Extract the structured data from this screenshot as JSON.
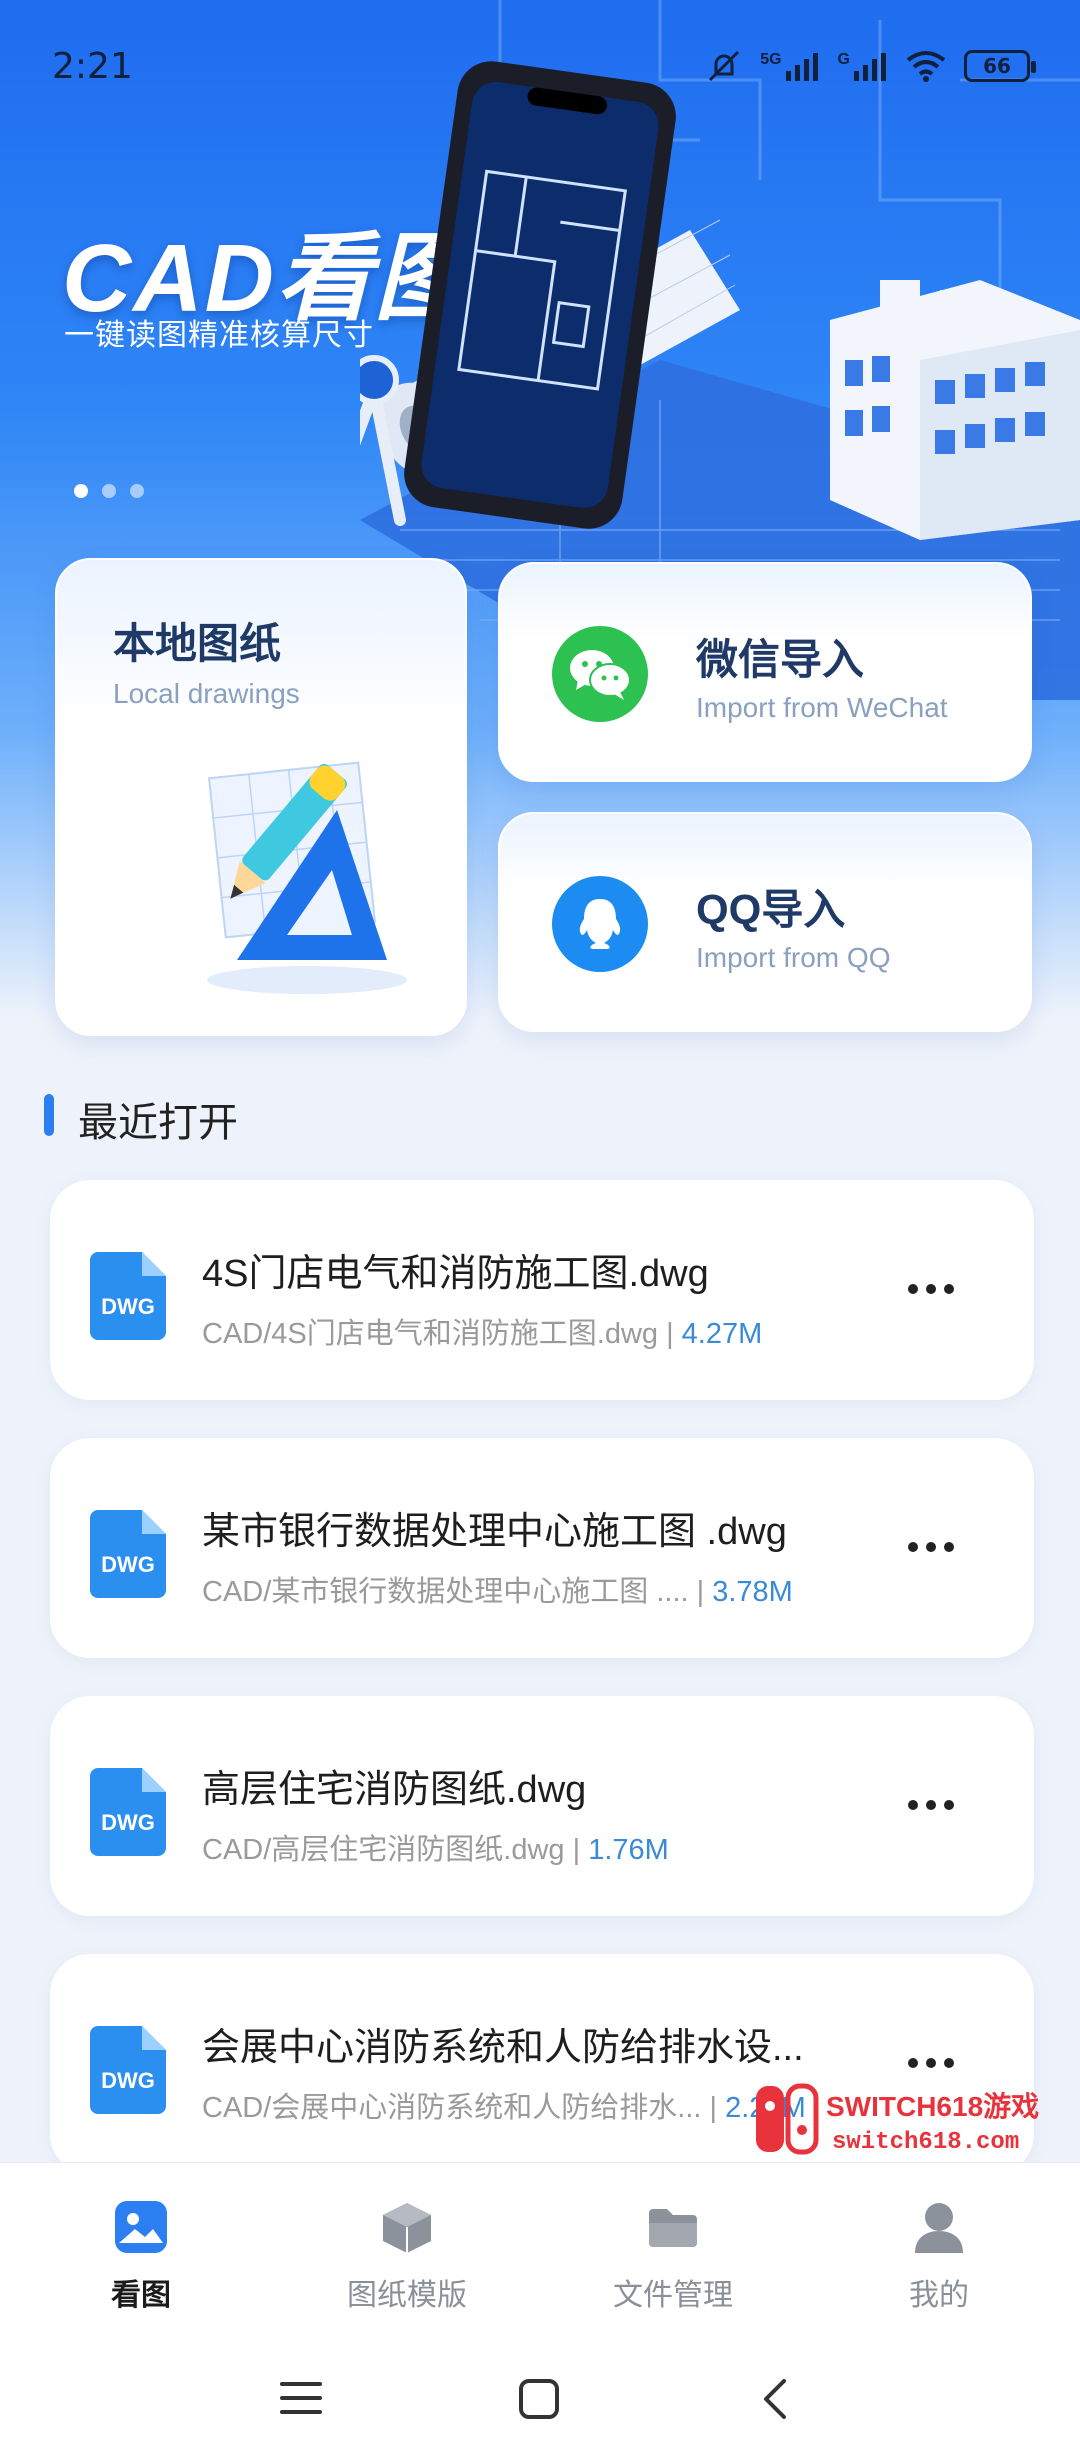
{
  "status_bar": {
    "time": "2:21",
    "network_a": "5G",
    "network_b": "G",
    "battery": "66"
  },
  "hero": {
    "title": "CAD看图",
    "subtitle": "一键读图精准核算尺寸",
    "carousel_pages": 3,
    "carousel_active": 0
  },
  "cards": {
    "local": {
      "title": "本地图纸",
      "subtitle": "Local drawings"
    },
    "wechat": {
      "title": "微信导入",
      "subtitle": "Import from WeChat"
    },
    "qq": {
      "title": "QQ导入",
      "subtitle": "Import from QQ"
    }
  },
  "recent": {
    "title": "最近打开",
    "files": [
      {
        "name": "4S门店电气和消防施工图.dwg",
        "path": "CAD/4S门店电气和消防施工图.dwg",
        "size": "4.27M",
        "icon": "DWG"
      },
      {
        "name": "某市银行数据处理中心施工图 .dwg",
        "path": "CAD/某市银行数据处理中心施工图 ....",
        "size": "3.78M",
        "icon": "DWG"
      },
      {
        "name": "高层住宅消防图纸.dwg",
        "path": "CAD/高层住宅消防图纸.dwg",
        "size": "1.76M",
        "icon": "DWG"
      },
      {
        "name": "会展中心消防系统和人防给排水设...",
        "path": "CAD/会展中心消防系统和人防给排水...",
        "size": "2.27M",
        "icon": "DWG"
      }
    ]
  },
  "watermark": {
    "line1": "SWITCH618游戏",
    "line2": "switch618.com"
  },
  "tabbar": {
    "tabs": [
      {
        "label": "看图",
        "icon": "image-icon",
        "active": true
      },
      {
        "label": "图纸模版",
        "icon": "cube-icon",
        "active": false
      },
      {
        "label": "文件管理",
        "icon": "folder-icon",
        "active": false
      },
      {
        "label": "我的",
        "icon": "user-icon",
        "active": false
      }
    ]
  },
  "colors": {
    "accent": "#2b7ff0",
    "wechat": "#2cc151",
    "qq": "#1c8cf2",
    "title_blue": "#1f3a66"
  }
}
